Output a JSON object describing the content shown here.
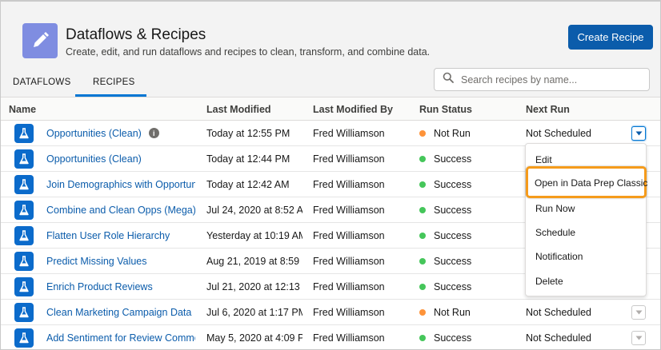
{
  "header": {
    "title": "Dataflows & Recipes",
    "subtitle": "Create, edit, and run dataflows and recipes to clean, transform, and combine data.",
    "create_button": "Create Recipe"
  },
  "tabs": [
    {
      "label": "DATAFLOWS",
      "active": false
    },
    {
      "label": "RECIPES",
      "active": true
    }
  ],
  "search": {
    "placeholder": "Search recipes by name..."
  },
  "columns": {
    "name": "Name",
    "last_modified": "Last Modified",
    "last_modified_by": "Last Modified By",
    "run_status": "Run Status",
    "next_run": "Next Run"
  },
  "rows": [
    {
      "name": "Opportunities (Clean)",
      "modified": "Today at 12:55 PM",
      "by": "Fred Williamson",
      "status": "Not Run",
      "status_type": "notrun",
      "next": "Not Scheduled",
      "info": "i"
    },
    {
      "name": "Opportunities (Clean)",
      "modified": "Today at 12:44 PM",
      "by": "Fred Williamson",
      "status": "Success",
      "status_type": "success",
      "next": ""
    },
    {
      "name": "Join Demographics with Opportun",
      "modified": "Today at 12:42 AM",
      "by": "Fred Williamson",
      "status": "Success",
      "status_type": "success",
      "next": ""
    },
    {
      "name": "Combine and Clean Opps (Mega)",
      "modified": "Jul 24, 2020 at 8:52 A",
      "by": "Fred Williamson",
      "status": "Success",
      "status_type": "success",
      "next": ""
    },
    {
      "name": "Flatten User Role Hierarchy",
      "modified": "Yesterday at 10:19 AM",
      "by": "Fred Williamson",
      "status": "Success",
      "status_type": "success",
      "next": ""
    },
    {
      "name": "Predict Missing Values",
      "modified": "Aug 21, 2019 at 8:59 .",
      "by": "Fred Williamson",
      "status": "Success",
      "status_type": "success",
      "next": ""
    },
    {
      "name": "Enrich Product Reviews",
      "modified": "Jul 21, 2020 at 12:13",
      "by": "Fred Williamson",
      "status": "Success",
      "status_type": "success",
      "next": ""
    },
    {
      "name": "Clean Marketing Campaign Data",
      "modified": "Jul 6, 2020 at 1:17 PM",
      "by": "Fred Williamson",
      "status": "Not Run",
      "status_type": "notrun",
      "next": "Not Scheduled"
    },
    {
      "name": "Add Sentiment for Review Comme",
      "modified": "May 5, 2020 at 4:09 P",
      "by": "Fred Williamson",
      "status": "Success",
      "status_type": "success",
      "next": "Not Scheduled"
    }
  ],
  "dropdown": {
    "items": [
      "Edit",
      "Open in Data Prep Classic",
      "Run Now",
      "Schedule",
      "Notification",
      "Delete"
    ]
  },
  "icons": {
    "app": "pencil-icon",
    "search": "search-icon",
    "recipe": "flask-icon",
    "menu": "chevron-down-icon"
  },
  "colors": {
    "brand": "#0b5cab",
    "highlight": "#f59b1b",
    "success": "#45c65a",
    "not_run": "#fe9339"
  }
}
